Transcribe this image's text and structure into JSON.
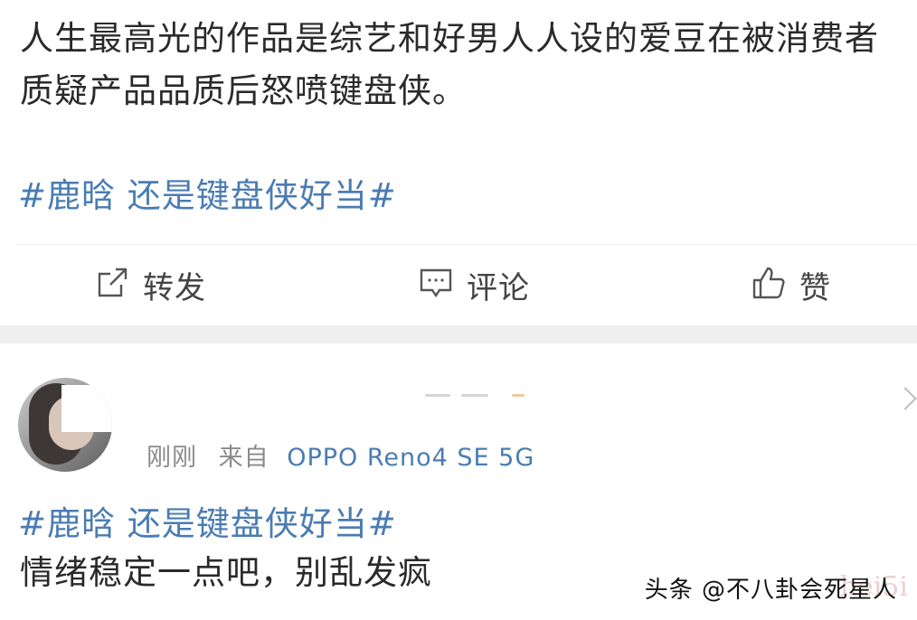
{
  "post1": {
    "text": "人生最高光的作品是综艺和好男人人设的爱豆在被消费者质疑产品品质后怒喷键盘侠。",
    "topic": "#鹿晗 还是键盘侠好当#",
    "actions": {
      "repost": {
        "label": "转发",
        "icon": "share-icon"
      },
      "comment": {
        "label": "评论",
        "icon": "comment-icon"
      },
      "like": {
        "label": "赞",
        "icon": "thumbs-up-icon"
      }
    }
  },
  "post2": {
    "meta_time": "刚刚",
    "meta_from": "来自",
    "meta_source": "OPPO Reno4 SE 5G",
    "topic": "#鹿晗 还是键盘侠好当#",
    "text": "情绪稳定一点吧，别乱发疯"
  },
  "watermark": "头条 @不八卦会死星人",
  "colors": {
    "link": "#4a7cb3",
    "meta": "#8a8a8a",
    "separator": "#efefef"
  }
}
